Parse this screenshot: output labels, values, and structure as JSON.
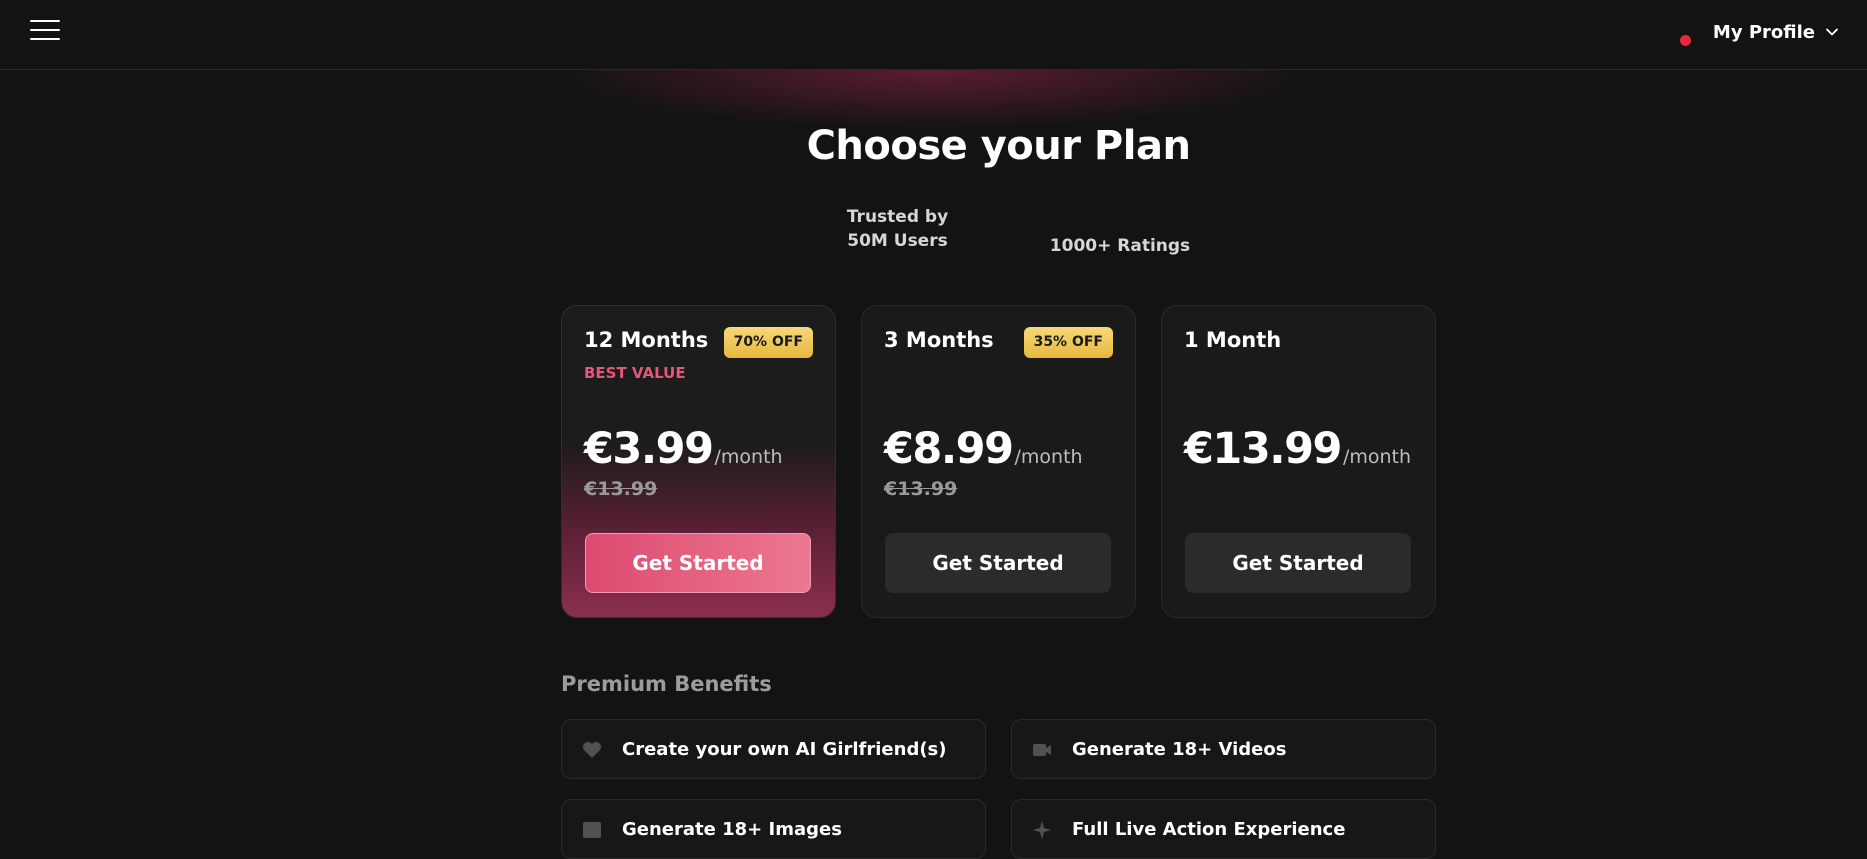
{
  "header": {
    "menu_icon": "hamburger-menu-icon",
    "profile_label": "My Profile",
    "status_color": "#e8283a",
    "dropdown_icon": "chevron-down-icon"
  },
  "hero": {
    "title": "Choose your Plan",
    "trust_users_line1": "Trusted by",
    "trust_users_line2": "50M Users",
    "trust_ratings": "1000+ Ratings"
  },
  "plans": [
    {
      "name": "12 Months",
      "badge": "70% OFF",
      "tag": "BEST VALUE",
      "price": "€3.99",
      "per": "/month",
      "old_price": "€13.99",
      "cta": "Get Started"
    },
    {
      "name": "3 Months",
      "badge": "35% OFF",
      "tag": "",
      "price": "€8.99",
      "per": "/month",
      "old_price": "€13.99",
      "cta": "Get Started"
    },
    {
      "name": "1 Month",
      "badge": "",
      "tag": "",
      "price": "€13.99",
      "per": "/month",
      "old_price": "",
      "cta": "Get Started"
    }
  ],
  "benefits": {
    "title": "Premium Benefits",
    "items": [
      {
        "label": "Create your own AI Girlfriend(s)",
        "icon": "heart-icon"
      },
      {
        "label": "Generate 18+ Videos",
        "icon": "video-icon"
      },
      {
        "label": "Generate 18+ Images",
        "icon": "image-icon"
      },
      {
        "label": "Full Live Action Experience",
        "icon": "sparkle-icon"
      }
    ]
  },
  "colors": {
    "accent": "#e5577a",
    "badge": "#f0cc5c",
    "background": "#131313"
  }
}
